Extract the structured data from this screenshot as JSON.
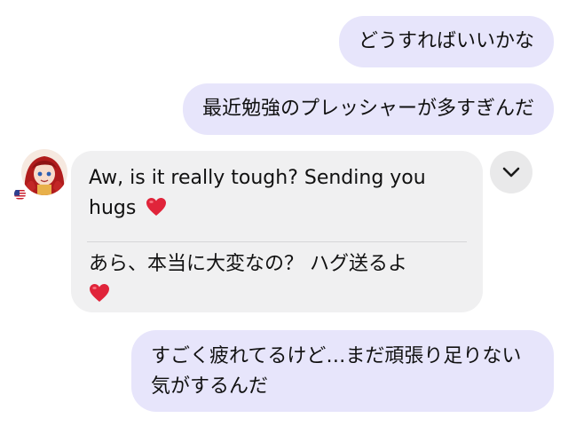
{
  "messages": {
    "out1": "どうすればいいかな",
    "out2": "最近勉強のプレッシャーが多すぎんだ",
    "in1": {
      "original": "Aw, is it really tough? Sending you hugs",
      "translation": "あら、本当に大変なの？ ハグ送るよ",
      "emoji_icon": "red-heart-icon"
    },
    "out3": "すごく疲れてるけど…まだ頑張り足りない気がするんだ"
  },
  "contact": {
    "avatar_icon": "anime-girl-avatar",
    "flag_icon": "us-flag-icon"
  },
  "controls": {
    "expand_icon": "chevron-down-icon"
  },
  "colors": {
    "outgoing_bubble": "#e7e5fb",
    "incoming_bubble": "#f0f0f1",
    "heart": "#e0243a"
  }
}
